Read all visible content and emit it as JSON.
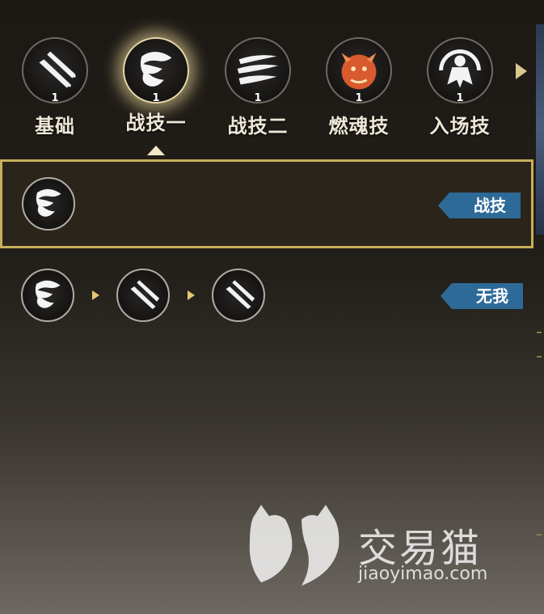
{
  "tabs": [
    {
      "label": "基础",
      "count": "1",
      "active": false,
      "icon": "twin-blades-icon"
    },
    {
      "label": "战技一",
      "count": "1",
      "active": true,
      "icon": "whirlwind-icon"
    },
    {
      "label": "战技二",
      "count": "1",
      "active": false,
      "icon": "claw-slashes-icon"
    },
    {
      "label": "燃魂技",
      "count": "1",
      "active": false,
      "icon": "dragon-head-icon"
    },
    {
      "label": "入场技",
      "count": "1",
      "active": false,
      "icon": "figure-entrance-icon"
    }
  ],
  "combos": [
    {
      "tag": "战技",
      "selected": true,
      "skills": [
        "whirlwind-icon"
      ]
    },
    {
      "tag": "无我",
      "selected": false,
      "skills": [
        "whirlwind-icon",
        "twin-blades-icon",
        "twin-blades-icon"
      ]
    }
  ],
  "watermark": {
    "cn": "交易猫",
    "url": "jiaoyimao.com"
  },
  "colors": {
    "accent_gold": "#c9ae5a",
    "tag_blue": "#2e6a98",
    "glow": "#ffecaa"
  }
}
